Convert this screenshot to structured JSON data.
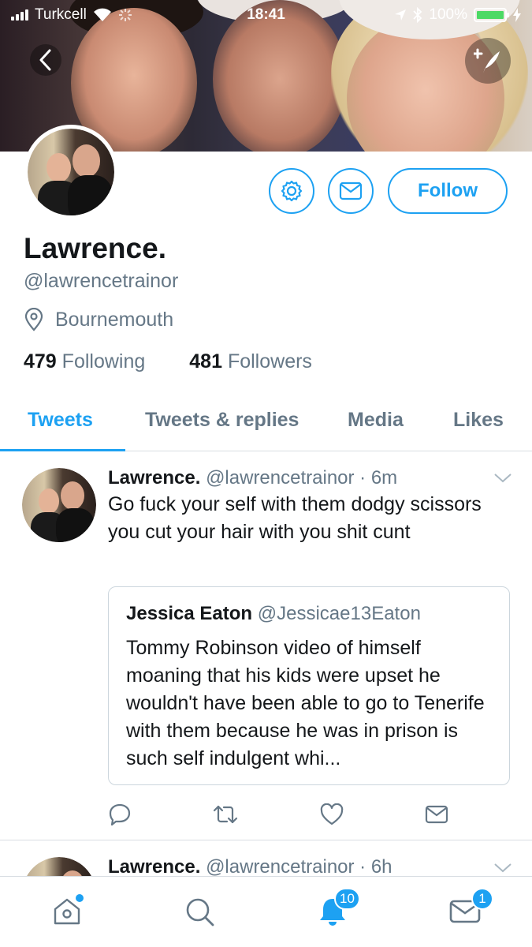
{
  "status_bar": {
    "carrier": "Turkcell",
    "time": "18:41",
    "battery": "100%"
  },
  "profile": {
    "name": "Lawrence.",
    "handle": "@lawrencetrainor",
    "location": "Bournemouth",
    "following_count": "479",
    "following_label": "Following",
    "followers_count": "481",
    "followers_label": "Followers",
    "follow_label": "Follow"
  },
  "tabs": [
    {
      "label": "Tweets",
      "active": true
    },
    {
      "label": "Tweets & replies",
      "active": false
    },
    {
      "label": "Media",
      "active": false
    },
    {
      "label": "Likes",
      "active": false
    }
  ],
  "tweets": [
    {
      "name": "Lawrence.",
      "handle": "@lawrencetrainor",
      "time": "6m",
      "text": "Go fuck your self with them dodgy scissors you cut your hair with you shit cunt",
      "quote": {
        "name": "Jessica Eaton",
        "handle": "@Jessicae13Eaton",
        "text": "Tommy Robinson video of himself moaning that his kids were upset he wouldn't have been able to go to Tenerife with them because he was in prison is such self indulgent whi..."
      }
    },
    {
      "name": "Lawrence.",
      "handle": "@lawrencetrainor",
      "time": "6h"
    }
  ],
  "bottom_nav": {
    "notifications_badge": "10",
    "messages_badge": "1"
  },
  "colors": {
    "accent": "#1da1f2",
    "secondary_text": "#657786",
    "primary_text": "#14171a"
  }
}
